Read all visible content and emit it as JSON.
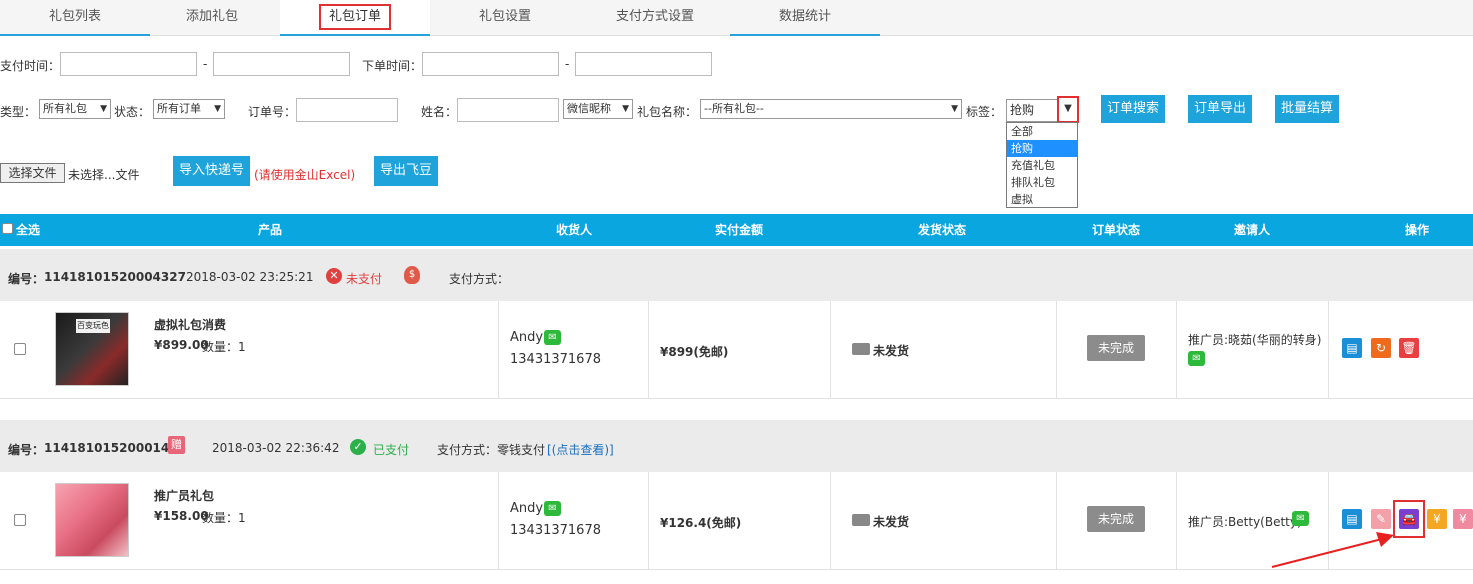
{
  "tabs": [
    "礼包列表",
    "添加礼包",
    "礼包订单",
    "礼包设置",
    "支付方式设置",
    "数据统计"
  ],
  "filters": {
    "pay_time_label": "支付时间：",
    "order_time_label": "下单时间：",
    "dash": "-",
    "type_label": "类型：",
    "type_value": "所有礼包",
    "status_label": "状态：",
    "status_value": "所有订单",
    "order_no_label": "订单号：",
    "name_label": "姓名：",
    "nickname_value": "微信昵称",
    "gift_name_label": "礼包名称：",
    "gift_name_value": "--所有礼包--",
    "tag_label": "标签：",
    "tag_value": "抢购",
    "tag_options": [
      "全部",
      "抢购",
      "充值礼包",
      "排队礼包",
      "虚拟"
    ],
    "search_btn": "订单搜索",
    "export_btn": "订单导出",
    "settle_btn": "批量结算",
    "choose_file_btn": "选择文件",
    "no_file_text": "未选择...文件",
    "import_btn": "导入快递号",
    "import_note": "(请使用金山Excel)",
    "export_feidou_btn": "导出飞豆"
  },
  "table": {
    "select_all": "全选",
    "columns": [
      "产品",
      "收货人",
      "实付金额",
      "发货状态",
      "订单状态",
      "邀请人",
      "操作"
    ]
  },
  "orders": [
    {
      "order_no_label": "编号：",
      "order_no": "11418101520004327",
      "time": "2018-03-02 23:25:21",
      "pay_status": "未支付",
      "pay_method": "支付方式：",
      "pay_link": "",
      "product_name": "虚拟礼包消费",
      "price": "¥899.00",
      "qty": "数量：1",
      "thumb_text": "百变玩色",
      "receiver": "Andy",
      "phone": "13431371678",
      "amount": "¥899(免邮)",
      "ship_status": "未发货",
      "order_status": "未完成",
      "inviter": "推广员:晓茹(华丽的转身)"
    },
    {
      "order_no_label": "编号：",
      "order_no": "11418101520001408",
      "gift_badge": "赠",
      "time": "2018-03-02 22:36:42",
      "pay_status": "已支付",
      "pay_method": "支付方式：零钱支付",
      "pay_link": "[(点击查看)]",
      "product_name": "推广员礼包",
      "price": "¥158.00",
      "qty": "数量：1",
      "receiver": "Andy",
      "phone": "13431371678",
      "amount": "¥126.4(免邮)",
      "ship_status": "未发货",
      "order_status": "未完成",
      "inviter": "推广员:Betty(Betty)"
    }
  ],
  "colors": {
    "tab_accent": "#26a3db",
    "button_blue": "#1ea3db",
    "header_blue": "#0aa6e0",
    "highlight_red": "#e03030",
    "wechat_green": "#2dba3a"
  }
}
